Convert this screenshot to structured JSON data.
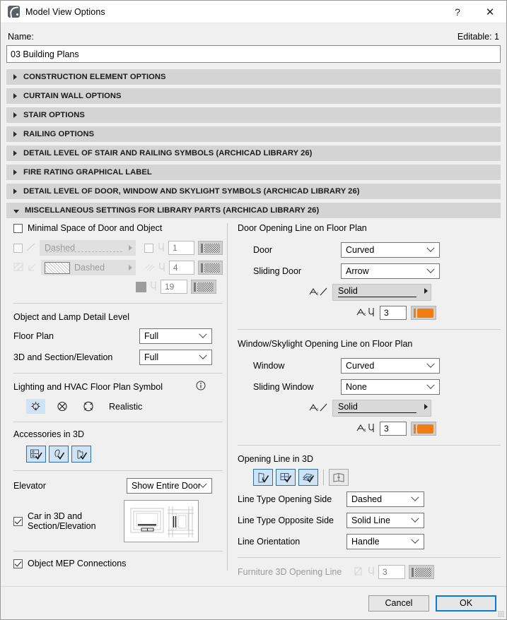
{
  "window": {
    "title": "Model View Options",
    "app_icon": "archicad-icon",
    "help_label": "?",
    "close_label": "✕"
  },
  "name_field": {
    "label": "Name:",
    "editable_label": "Editable: 1",
    "value": "03 Building Plans",
    "placeholder": ""
  },
  "sections": [
    {
      "label": "CONSTRUCTION ELEMENT OPTIONS",
      "expanded": false
    },
    {
      "label": "CURTAIN WALL OPTIONS",
      "expanded": false
    },
    {
      "label": "STAIR OPTIONS",
      "expanded": false
    },
    {
      "label": "RAILING OPTIONS",
      "expanded": false
    },
    {
      "label": "DETAIL LEVEL OF STAIR AND RAILING SYMBOLS (ARCHICAD LIBRARY 26)",
      "expanded": false
    },
    {
      "label": "FIRE RATING GRAPHICAL LABEL",
      "expanded": false
    },
    {
      "label": "DETAIL LEVEL OF DOOR, WINDOW AND SKYLIGHT SYMBOLS (ARCHICAD LIBRARY 26)",
      "expanded": false
    },
    {
      "label": "MISCELLANEOUS SETTINGS FOR LIBRARY PARTS (ARCHICAD LIBRARY 26)",
      "expanded": true
    }
  ],
  "left": {
    "minimal_space": {
      "label": "Minimal Space of Door and Object",
      "checked": false,
      "rows": [
        {
          "line_style": "Dashed",
          "pen": "1",
          "enabled": false
        },
        {
          "line_style": "Dashed",
          "pen": "4",
          "enabled": false
        },
        {
          "line_style": "",
          "pen": "19",
          "enabled": false
        }
      ]
    },
    "detail_level": {
      "title": "Object and Lamp Detail Level",
      "floor_plan_label": "Floor Plan",
      "floor_plan_value": "Full",
      "section_label": "3D and Section/Elevation",
      "section_value": "Full"
    },
    "lighting": {
      "title": "Lighting and HVAC Floor Plan Symbol",
      "info_icon": "info-icon",
      "options": [
        "lamp-symbol-icon",
        "crossed-circle-icon",
        "hvac-symbol-icon"
      ],
      "selected_index": 0,
      "mode_label": "Realistic"
    },
    "accessories": {
      "title": "Accessories in 3D",
      "buttons": [
        "accessory-cabinet-icon",
        "accessory-lamp-icon",
        "accessory-fixture-icon"
      ]
    },
    "elevator": {
      "label": "Elevator",
      "value": "Show Entire Door",
      "preview": "elevator-preview-image",
      "car_label": "Car in 3D and Section/Elevation",
      "car_checked": true
    },
    "mep": {
      "label": "Object MEP Connections",
      "checked": true
    }
  },
  "right": {
    "door_opening": {
      "title": "Door Opening Line on Floor Plan",
      "door_label": "Door",
      "door_value": "Curved",
      "sliding_label": "Sliding Door",
      "sliding_value": "Arrow",
      "line_type_value": "Solid",
      "pen": "3",
      "pen_color": "#f07c12"
    },
    "window_opening": {
      "title": "Window/Skylight Opening Line on Floor Plan",
      "window_label": "Window",
      "window_value": "Curved",
      "sliding_label": "Sliding Window",
      "sliding_value": "None",
      "line_type_value": "Solid",
      "pen": "3",
      "pen_color": "#f07c12"
    },
    "opening_3d": {
      "title": "Opening Line in 3D",
      "buttons": [
        "door-3d-icon",
        "window-3d-icon",
        "skylight-3d-icon",
        "furniture-3d-icon"
      ],
      "selected": [
        true,
        true,
        true,
        false
      ],
      "line_open_label": "Line Type Opening Side",
      "line_open_value": "Dashed",
      "line_opp_label": "Line Type Opposite Side",
      "line_opp_value": "Solid Line",
      "orientation_label": "Line Orientation",
      "orientation_value": "Handle",
      "furniture_label": "Furniture 3D Opening Line",
      "furniture_pen": "3",
      "furniture_enabled": false
    }
  },
  "footer": {
    "cancel": "Cancel",
    "ok": "OK"
  }
}
